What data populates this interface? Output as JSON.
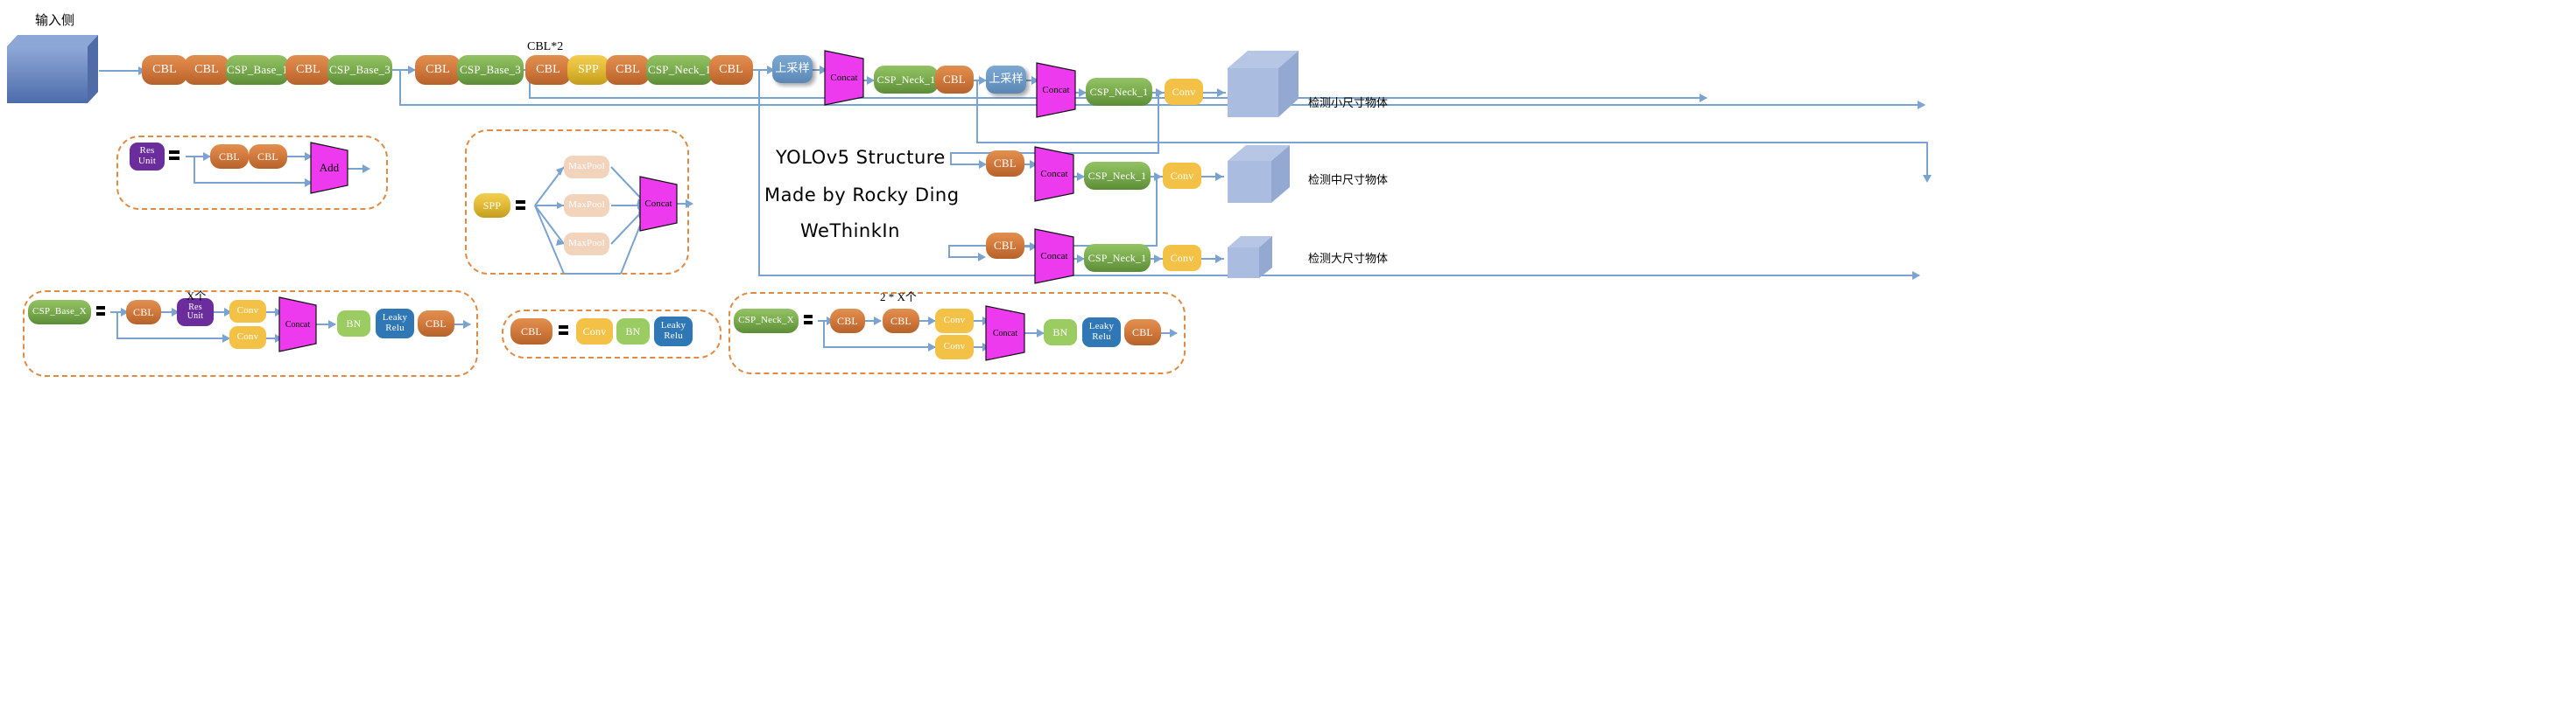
{
  "meta": {
    "title_lines": [
      "YOLOv5 Structure",
      "Made by Rocky Ding",
      "WeThinkIn"
    ],
    "input_label": "输入侧",
    "cbl_x2_label": "CBL*2"
  },
  "colors": {
    "cbl": "#d47b3e",
    "csp": "#7cae50",
    "spp": "#e4bb37",
    "conv": "#f3c146",
    "bn": "#9bcc62",
    "leaky_relu": "#2f77b5",
    "res_unit": "#6a2d9b",
    "upsample": "#6d9ac6",
    "concat": "#ee3aee",
    "maxpool": "#f2d3bb",
    "wire": "#7ba3d0",
    "legend_border": "#e08a43",
    "cube": "#a8bcdf"
  },
  "backbone": {
    "blocks": [
      {
        "label": "CBL",
        "type": "cbl"
      },
      {
        "label": "CBL",
        "type": "cbl"
      },
      {
        "label": "CSP_Base_1",
        "type": "csp"
      },
      {
        "label": "CBL",
        "type": "cbl"
      },
      {
        "label": "CSP_Base_3",
        "type": "csp"
      }
    ],
    "blocks2": [
      {
        "label": "CBL",
        "type": "cbl"
      },
      {
        "label": "CSP_Base_3",
        "type": "csp"
      }
    ],
    "blocks3": [
      {
        "label": "CBL",
        "type": "cbl"
      },
      {
        "label": "SPP",
        "type": "spp"
      },
      {
        "label": "CBL",
        "type": "cbl"
      },
      {
        "label": "CSP_Neck_1",
        "type": "csp"
      },
      {
        "label": "CBL",
        "type": "cbl"
      }
    ]
  },
  "neck": {
    "upsample1": "上采样",
    "concat1": "Concat",
    "csp_neck_a": "CSP_Neck_1",
    "cbl_a": "CBL",
    "upsample2": "上采样",
    "concat2": "Concat",
    "csp_neck_b": "CSP_Neck_1",
    "conv_small": "Conv",
    "cbl_mid": "CBL",
    "concat3": "Concat",
    "csp_neck_c": "CSP_Neck_1",
    "conv_mid": "Conv",
    "cbl_large": "CBL",
    "concat4": "Concat",
    "csp_neck_d": "CSP_Neck_1",
    "conv_large": "Conv"
  },
  "outputs": [
    {
      "label": "检测小尺寸物体"
    },
    {
      "label": "检测中尺寸物体"
    },
    {
      "label": "检测大尺寸物体"
    }
  ],
  "legend_res_unit": {
    "name": "Res\nUnit",
    "name_l1": "Res",
    "name_l2": "Unit",
    "blocks": [
      "CBL",
      "CBL"
    ],
    "op": "Add"
  },
  "legend_spp": {
    "name": "SPP",
    "branches": [
      "MaxPool",
      "MaxPool",
      "MaxPool"
    ],
    "op": "Concat"
  },
  "legend_csp_base": {
    "name": "CSP_Base_X",
    "repeat_label": "X个",
    "top_path": [
      "CBL",
      "Res\nUnit",
      "Conv"
    ],
    "res_l1": "Res",
    "res_l2": "Unit",
    "bottom_path": [
      "Conv"
    ],
    "op": "Concat",
    "tail": [
      "BN",
      "Leaky\nRelu",
      "CBL"
    ],
    "relu_l1": "Leaky",
    "relu_l2": "Relu"
  },
  "legend_cbl": {
    "name": "CBL",
    "parts": [
      "Conv",
      "BN",
      "Leaky\nRelu"
    ],
    "relu_l1": "Leaky",
    "relu_l2": "Relu"
  },
  "legend_csp_neck": {
    "name": "CSP_Neck_X",
    "repeat_label": "2 * X个",
    "top_path": [
      "CBL",
      "CBL",
      "Conv"
    ],
    "bottom_path": [
      "Conv"
    ],
    "op": "Concat",
    "tail": [
      "BN",
      "Leaky\nRelu",
      "CBL"
    ],
    "relu_l1": "Leaky",
    "relu_l2": "Relu"
  }
}
